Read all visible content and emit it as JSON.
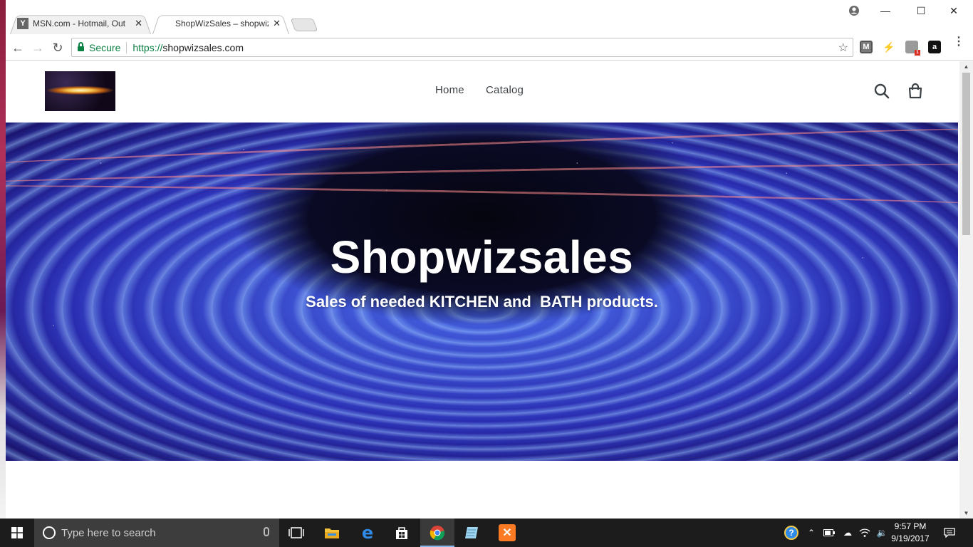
{
  "browser": {
    "tabs": [
      {
        "favicon": "msn-favicon",
        "title": "MSN.com - Hotmail, Out",
        "close": "✕"
      },
      {
        "favicon": "shopify-favicon",
        "title": "ShopWizSales – shopwiz",
        "close": "✕"
      }
    ],
    "window_controls": {
      "minimize": "—",
      "maximize": "☐",
      "close": "✕"
    },
    "toolbar": {
      "back": "←",
      "forward": "→",
      "reload": "↻",
      "secure_label": "Secure",
      "url_scheme": "https://",
      "url_domain": "shopwizsales.com",
      "bookmark_star": "☆",
      "extensions": [
        "m-extension-icon",
        "flash-extension-icon",
        "notification-extension-icon",
        "amazon-extension-icon"
      ],
      "menu": "⋮"
    }
  },
  "site": {
    "nav": [
      {
        "label": "Home"
      },
      {
        "label": "Catalog"
      }
    ],
    "icons": [
      "search-icon",
      "cart-icon"
    ],
    "hero": {
      "title": "Shopwizsales",
      "subtitle": "Sales of needed KITCHEN and  BATH products."
    }
  },
  "taskbar": {
    "search_placeholder": "Type here to search",
    "pinned": [
      "task-view-icon",
      "file-explorer-icon",
      "edge-icon",
      "store-icon",
      "chrome-icon",
      "notepad-icon",
      "xampp-icon"
    ],
    "clock": {
      "time": "9:57 PM",
      "date": "9/19/2017"
    }
  },
  "colors": {
    "secure_green": "#0b8043",
    "taskbar": "#1c1c1c",
    "hero_blue": "#2a2cb0",
    "xampp_orange": "#fb7a24"
  }
}
